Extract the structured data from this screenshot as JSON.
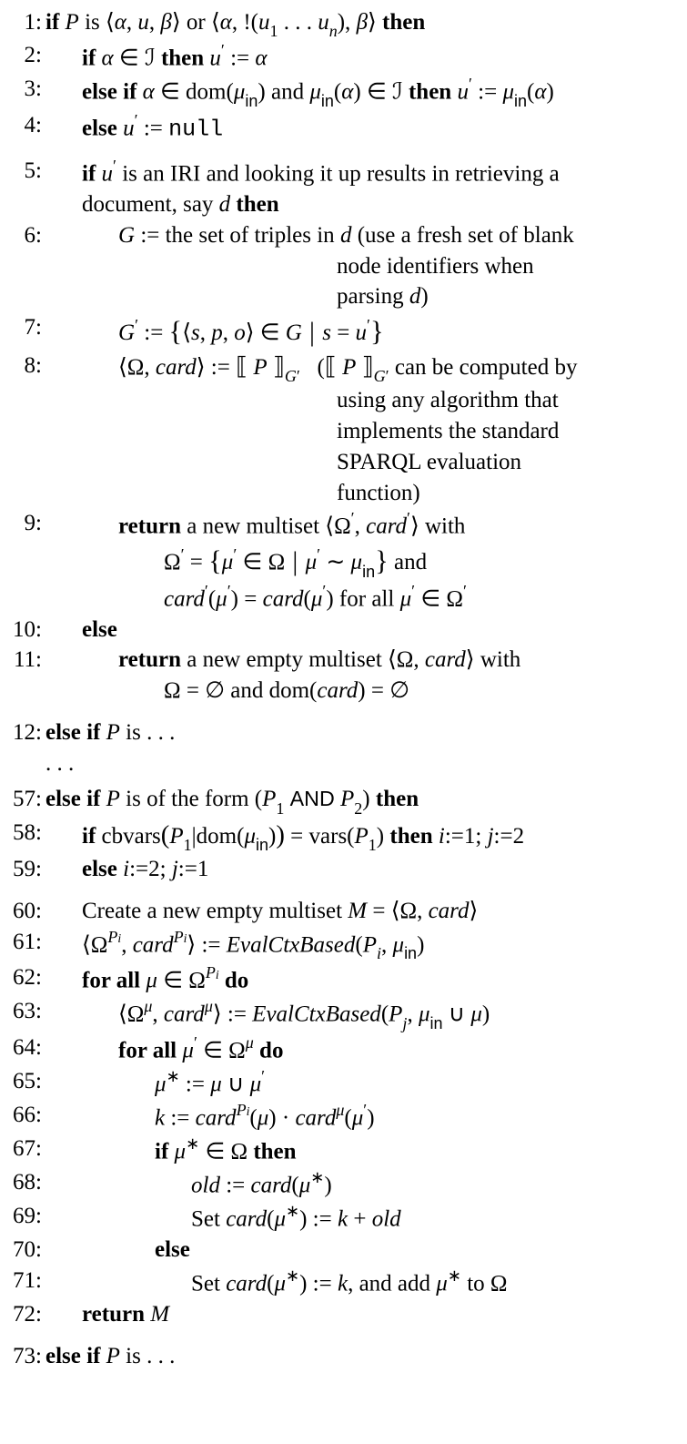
{
  "kw": {
    "if": "if",
    "then": "then",
    "else": "else",
    "elseif": "else if",
    "return": "return",
    "forall": "for all",
    "do": "do"
  },
  "sym": {
    "langle": "⟨",
    "rangle": "⟩",
    "alpha": "α",
    "beta": "β",
    "mu": "μ",
    "Omega": "Ω",
    "in_sf": "in",
    "prime": "′",
    "star": "∗",
    "in_rel": "∈",
    "assign": ":=",
    "empty": "∅",
    "cup": "∪",
    "sim": "∼",
    "cdot": "·",
    "scriptI": "ℐ",
    "null": "null",
    "ldots3": ". . .",
    "ldots": "…",
    "AND": "AND"
  },
  "lines": {
    "l1": {
      "n": "1",
      "t_or": " or ",
      "t_bang": "!(",
      "t_close": "), "
    },
    "l2": {
      "n": "2",
      "t_then_u": " then ",
      "t_eq_alpha": " := "
    },
    "l3": {
      "n": "3",
      "t_dom": "dom(",
      "t_and": " and ",
      "t_cl": ")",
      "t_in": " ∈ ",
      "t_then_u": " then "
    },
    "l4": {
      "n": "4"
    },
    "l5": {
      "n": "5",
      "t_body": " is an IRI and looking it up results in retrieving a",
      "t_body2": "document, say ",
      "t_d": "d"
    },
    "l6": {
      "n": "6",
      "t_G": "G",
      "t_body": " := the set of triples in ",
      "t_d": "d",
      "t_note1": " (use a fresh set of blank",
      "t_note2": "node identifiers when",
      "t_note3": "parsing ",
      "t_close": ")"
    },
    "l7": {
      "n": "7",
      "t_Gp": "G",
      "t_spo": "s",
      "t_p": "p",
      "t_o": "o",
      "t_eq": " = "
    },
    "l8": {
      "n": "8",
      "t_card": "card",
      "t_P": "P",
      "t_note1": " can be computed by",
      "t_note2": "using any algorithm that",
      "t_note3": "implements the standard",
      "t_note4": "SPARQL evaluation",
      "t_note5": "function)"
    },
    "l9": {
      "n": "9",
      "t_body": "  a new multiset ",
      "t_with": " with",
      "t_and": " and",
      "t_for": " for all "
    },
    "l10": {
      "n": "10"
    },
    "l11": {
      "n": "11",
      "t_body": "  a new empty multiset ",
      "t_with": " with",
      "t_eq": " = ",
      "t_anddom": " and dom(",
      "t_card": "card",
      "t_cl": ") = "
    },
    "l12": {
      "n": "12",
      "t_is": " is "
    },
    "l57": {
      "n": "57",
      "t_is": " is of the form (",
      "t_P1": "P",
      "t_P2": "P",
      "t_cl": ") "
    },
    "l58": {
      "n": "58",
      "t_cb": " cbvars",
      "t_pipe": "|",
      "t_dom": "dom(",
      "t_cl": ")",
      "t_eq": " = ",
      "t_vars": "vars(",
      "t_then": " then ",
      "t_i": "i",
      "t_j": "j",
      "t_1": "1",
      "t_2": "2",
      "t_sc": "; "
    },
    "l59": {
      "n": "59"
    },
    "l60": {
      "n": "60",
      "t_body": "Create a new empty multiset ",
      "t_M": "M",
      "t_eq": " = "
    },
    "l61": {
      "n": "61",
      "t_fn": "EvalCtxBased",
      "t_Pi": "P"
    },
    "l62": {
      "n": "62"
    },
    "l63": {
      "n": "63",
      "t_fn": "EvalCtxBased",
      "t_Pj": "P"
    },
    "l64": {
      "n": "64"
    },
    "l65": {
      "n": "65"
    },
    "l66": {
      "n": "66",
      "t_k": "k"
    },
    "l67": {
      "n": "67"
    },
    "l68": {
      "n": "68",
      "t_old": "old"
    },
    "l69": {
      "n": "69",
      "t_set": "Set ",
      "t_plus": " + ",
      "t_old": "old"
    },
    "l70": {
      "n": "70"
    },
    "l71": {
      "n": "71",
      "t_set": "Set ",
      "t_add": ", and add ",
      "t_to": " to "
    },
    "l72": {
      "n": "72",
      "t_M": "M"
    },
    "l73": {
      "n": "73",
      "t_is": " is "
    }
  }
}
